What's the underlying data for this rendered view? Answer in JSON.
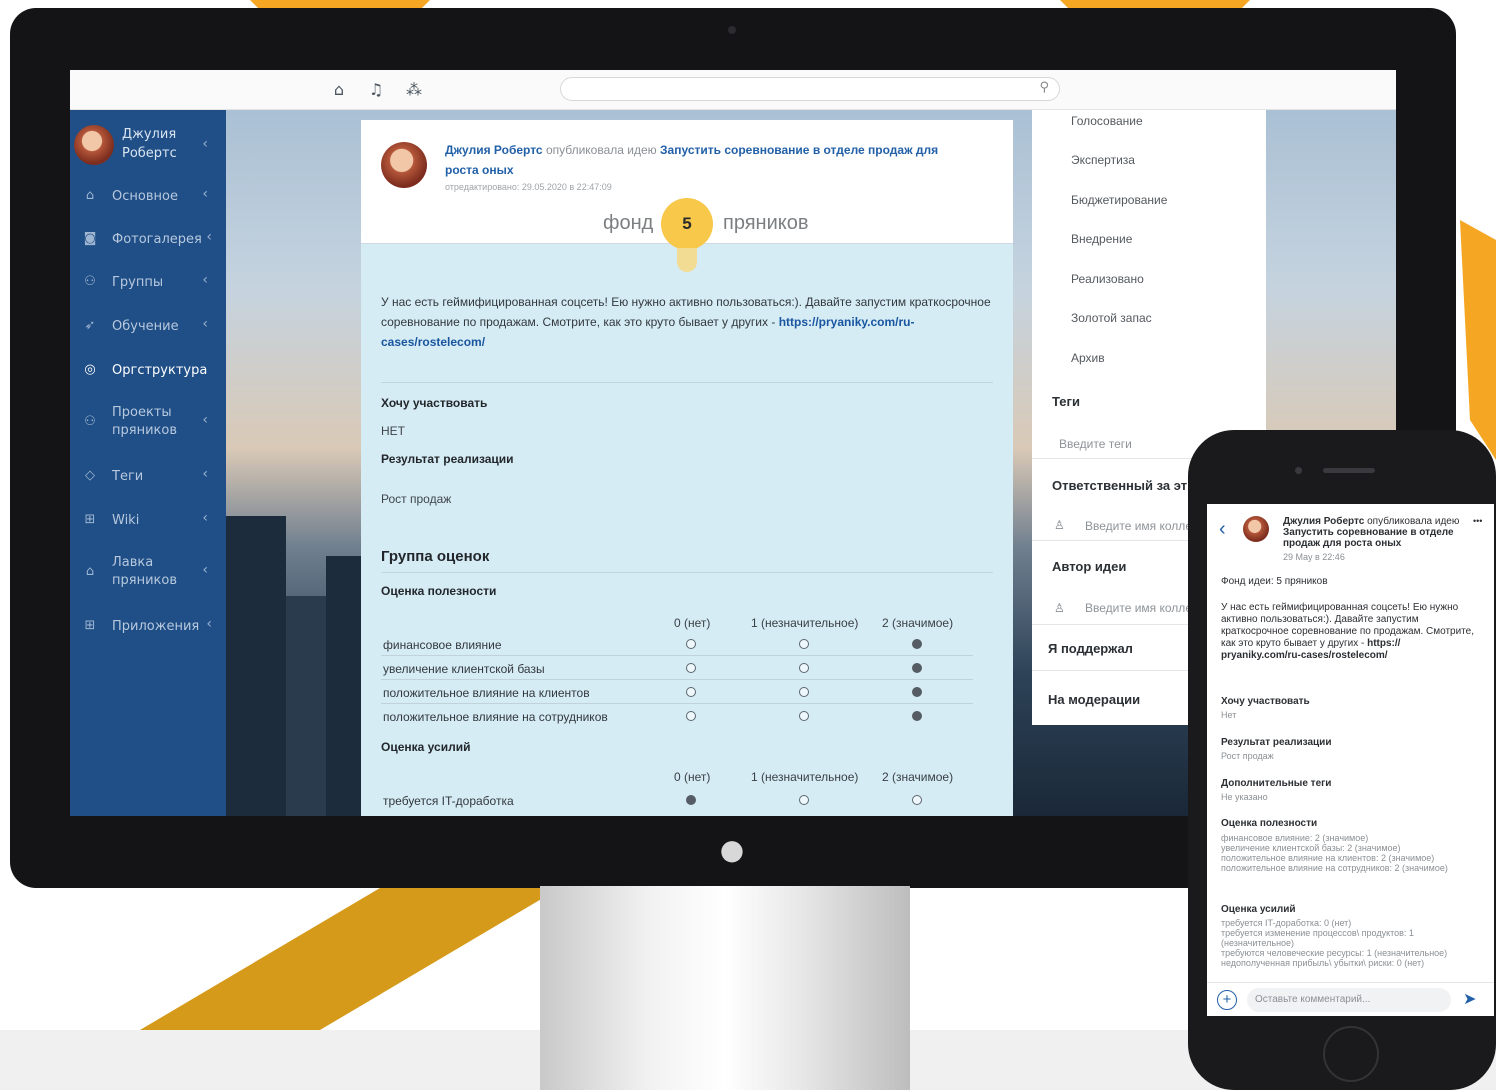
{
  "topbar": {
    "icons": [
      "home-icon",
      "bell-icon",
      "network-icon",
      "search-icon"
    ]
  },
  "sidebar": {
    "user": {
      "name": "Джулия Робертс"
    },
    "items": [
      {
        "label": "Основное",
        "icon": "home-icon"
      },
      {
        "label": "Фотогалерея",
        "icon": "camera-icon"
      },
      {
        "label": "Группы",
        "icon": "group-icon"
      },
      {
        "label": "Обучение",
        "icon": "rocket-icon"
      },
      {
        "label": "Оргструктура",
        "icon": "org-icon",
        "active": true
      },
      {
        "label": "Проекты пряников",
        "icon": "projects-icon"
      },
      {
        "label": "Теги",
        "icon": "tag-icon"
      },
      {
        "label": "Wiki",
        "icon": "wiki-icon"
      },
      {
        "label": "Лавка пряников",
        "icon": "shop-icon"
      },
      {
        "label": "Приложения",
        "icon": "apps-icon"
      }
    ]
  },
  "post": {
    "author": "Джулия Робертс",
    "action": "опубликовала идею",
    "title": "Запустить соревнование в отделе продаж для роста оных",
    "edited": "отредактировано: 29.05.2020 в 22:47:09",
    "fund_left": "фонд",
    "fund_value": "5",
    "fund_right": "пряников",
    "text": "У нас есть геймифицированная соцсеть! Ею нужно активно пользоваться:). Давайте запустим краткосрочное соревнование по продажам. Смотрите, как это круто бывает у других -",
    "link": "https://pryaniky.com/ru-cases/rostelecom/",
    "want_label": "Хочу участвовать",
    "want_value": "НЕТ",
    "result_label": "Результат реализации",
    "result_value": "Рост продаж",
    "group_title": "Группа оценок",
    "usefulness_title": "Оценка полезности",
    "columns": [
      "0 (нет)",
      "1 (незначительное)",
      "2 (значимое)"
    ],
    "usefulness_rows": [
      {
        "label": "финансовое влияние",
        "selected": 2
      },
      {
        "label": "увеличение клиентской базы",
        "selected": 2
      },
      {
        "label": "положительное влияние на клиентов",
        "selected": 2
      },
      {
        "label": "положительное влияние на сотрудников",
        "selected": 2
      }
    ],
    "effort_title": "Оценка усилий",
    "effort_rows": [
      {
        "label": "требуется IT-доработка",
        "selected": 0
      }
    ]
  },
  "right_panel": {
    "statuses": [
      "Голосование",
      "Экспертиза",
      "Бюджетирование",
      "Внедрение",
      "Реализовано",
      "Золотой запас",
      "Архив"
    ],
    "tags_title": "Теги",
    "tags_placeholder": "Введите теги",
    "responsible_title": "Ответственный за эт",
    "responsible_placeholder": "Введите имя колле",
    "author_title": "Автор идеи",
    "author_placeholder": "Введите имя колле",
    "supported": "Я поддержал",
    "moderation": "На модерации"
  },
  "phone": {
    "header": "Джулия Робертс опубликовала идею Запустить соревнование в отделе продаж для роста оных",
    "header_author": "Джулия Робертс",
    "header_action": " опубликовала идею ",
    "header_title": "Запустить соревнование в отделе продаж для роста оных",
    "date": "29 May в 22:46",
    "more": "•••",
    "fund": "Фонд идеи: 5 пряников",
    "text": "У нас есть геймифицированная соцсеть! Ею нужно активно пользоваться:). Давайте запустим краткосрочное соревнование по продажам. Смотрите, как это круто бывает у других - ",
    "link": "https:// pryaniky.com/ru-cases/rostelecom/",
    "want_label": "Хочу участвовать",
    "want_value": "Нет",
    "result_label": "Результат реализации",
    "result_value": "Рост продаж",
    "tags_label": "Дополнительные теги",
    "tags_value": "Не указано",
    "usefulness_label": "Оценка полезности",
    "usefulness_lines": [
      "финансовое влияние: 2 (значимое)",
      "увеличение клиентской базы: 2 (значимое)",
      "положительное влияние на клиентов: 2 (значимое)",
      "положительное влияние на сотрудников: 2 (значимое)"
    ],
    "effort_label": "Оценка усилий",
    "effort_lines": [
      "требуется IT-доработка: 0 (нет)",
      "требуется изменение процессов\\ продуктов: 1",
      "(незначительное)",
      "требуются человеческие ресурсы: 1 (незначительное)",
      "недополученная прибыль\\ убытки\\ риски: 0 (нет)"
    ],
    "comment_placeholder": "Оставьте комментарий..."
  },
  "colors": {
    "sidebar": "#1f4f86",
    "accent": "#f5a623",
    "link": "#2260a8",
    "bulb": "#f7c84a"
  }
}
